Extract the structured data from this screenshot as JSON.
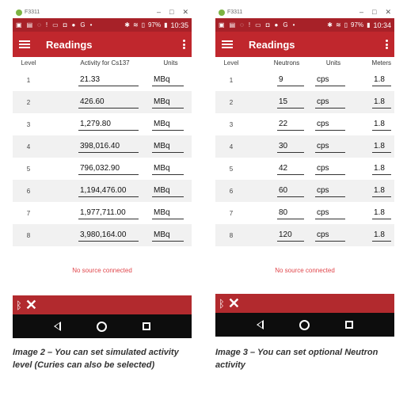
{
  "left": {
    "window_title": "F3311",
    "status": {
      "battery": "97%",
      "time": "10:35"
    },
    "app_title": "Readings",
    "headers": {
      "level": "Level",
      "activity": "Activity for Cs137",
      "units": "Units"
    },
    "rows": [
      {
        "level": "1",
        "activity": "21.33",
        "units": "MBq"
      },
      {
        "level": "2",
        "activity": "426.60",
        "units": "MBq"
      },
      {
        "level": "3",
        "activity": "1,279.80",
        "units": "MBq"
      },
      {
        "level": "4",
        "activity": "398,016.40",
        "units": "MBq"
      },
      {
        "level": "5",
        "activity": "796,032.90",
        "units": "MBq"
      },
      {
        "level": "6",
        "activity": "1,194,476.00",
        "units": "MBq"
      },
      {
        "level": "7",
        "activity": "1,977,711.00",
        "units": "MBq"
      },
      {
        "level": "8",
        "activity": "3,980,164.00",
        "units": "MBq"
      }
    ],
    "no_source": "No source connected",
    "caption": "Image 2 – You can set simulated activity level (Curies can also be selected)"
  },
  "right": {
    "window_title": "F3311",
    "status": {
      "battery": "97%",
      "time": "10:34"
    },
    "app_title": "Readings",
    "headers": {
      "level": "Level",
      "neutrons": "Neutrons",
      "units": "Units",
      "meters": "Meters"
    },
    "rows": [
      {
        "level": "1",
        "neutrons": "9",
        "units": "cps",
        "meters": "1.8"
      },
      {
        "level": "2",
        "neutrons": "15",
        "units": "cps",
        "meters": "1.8"
      },
      {
        "level": "3",
        "neutrons": "22",
        "units": "cps",
        "meters": "1.8"
      },
      {
        "level": "4",
        "neutrons": "30",
        "units": "cps",
        "meters": "1.8"
      },
      {
        "level": "5",
        "neutrons": "42",
        "units": "cps",
        "meters": "1.8"
      },
      {
        "level": "6",
        "neutrons": "60",
        "units": "cps",
        "meters": "1.8"
      },
      {
        "level": "7",
        "neutrons": "80",
        "units": "cps",
        "meters": "1.8"
      },
      {
        "level": "8",
        "neutrons": "120",
        "units": "cps",
        "meters": "1.8"
      }
    ],
    "no_source": "No source connected",
    "caption": "Image 3 – You can set optional Neutron activity"
  },
  "icons": {
    "window_controls": [
      "minimize-icon",
      "maximize-icon",
      "close-icon"
    ],
    "status_left": [
      "notification-icons"
    ],
    "bluetooth": "bluetooth-icon",
    "close_connection": "close-x-icon",
    "nav": [
      "back-icon",
      "home-icon",
      "recents-icon"
    ]
  },
  "colors": {
    "status_bar": "#a72128",
    "app_bar": "#c0272d",
    "bt_bar": "#b22a2e",
    "nav_bar": "#0d0d0d",
    "no_source_text": "#e0464b"
  }
}
